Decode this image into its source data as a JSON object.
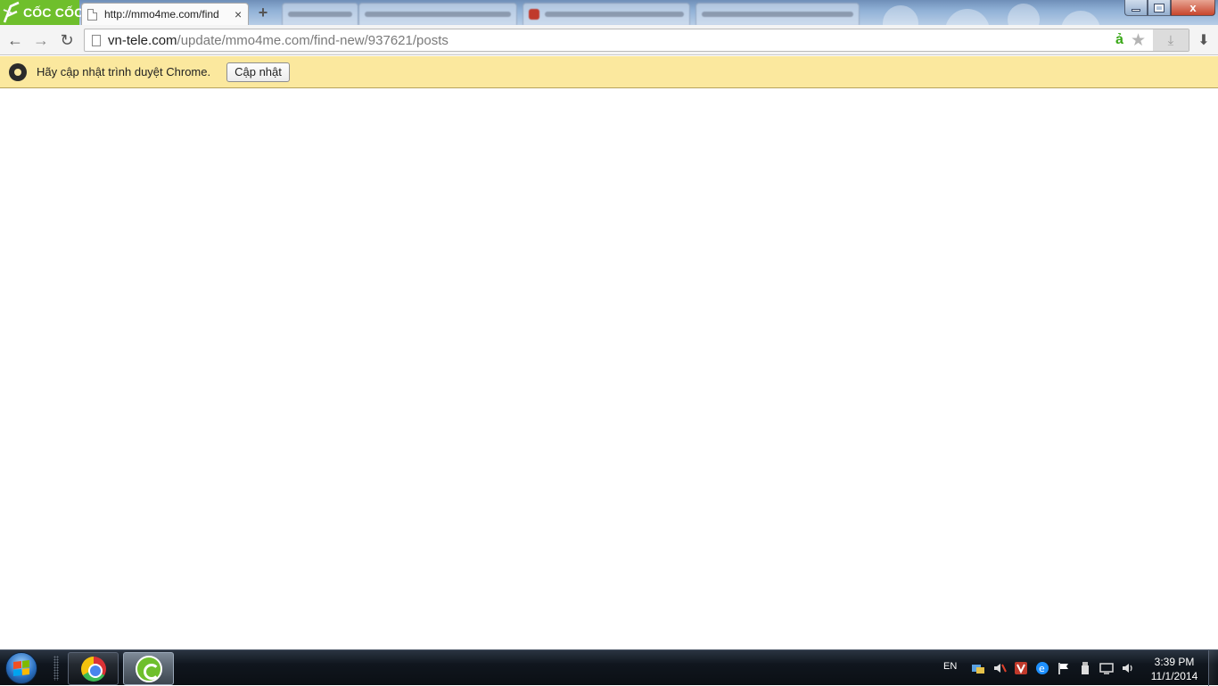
{
  "browser": {
    "brand": "CỐC CỐC",
    "active_tab": {
      "title": "http://mmo4me.com/find",
      "close": "×"
    },
    "new_tab": "+",
    "window_controls": {
      "close": "x"
    }
  },
  "toolbar": {
    "back": "←",
    "forward": "→",
    "reload": "↻",
    "url_host": "vn-tele.com",
    "url_path": "/update/mmo4me.com/find-new/937621/posts",
    "coccoc_a": "ả",
    "star": "★",
    "download_box": "⤓",
    "download": "⬇"
  },
  "infobar": {
    "message": "Hãy cập nhật trình duyệt Chrome.",
    "button_label": "Cập nhật"
  },
  "taskbar": {
    "language": "EN",
    "time": "3:39 PM",
    "date": "11/1/2014",
    "tray_icons": [
      "network-icon",
      "volume-muted-icon",
      "v-app-icon",
      "ie-icon",
      "flag-icon",
      "usb-icon",
      "monitor-icon",
      "speaker-icon"
    ]
  },
  "colors": {
    "coccoc_green": "#6fbf2c",
    "infobar_bg": "#fbe89e",
    "taskbar_bg": "#10161e"
  }
}
